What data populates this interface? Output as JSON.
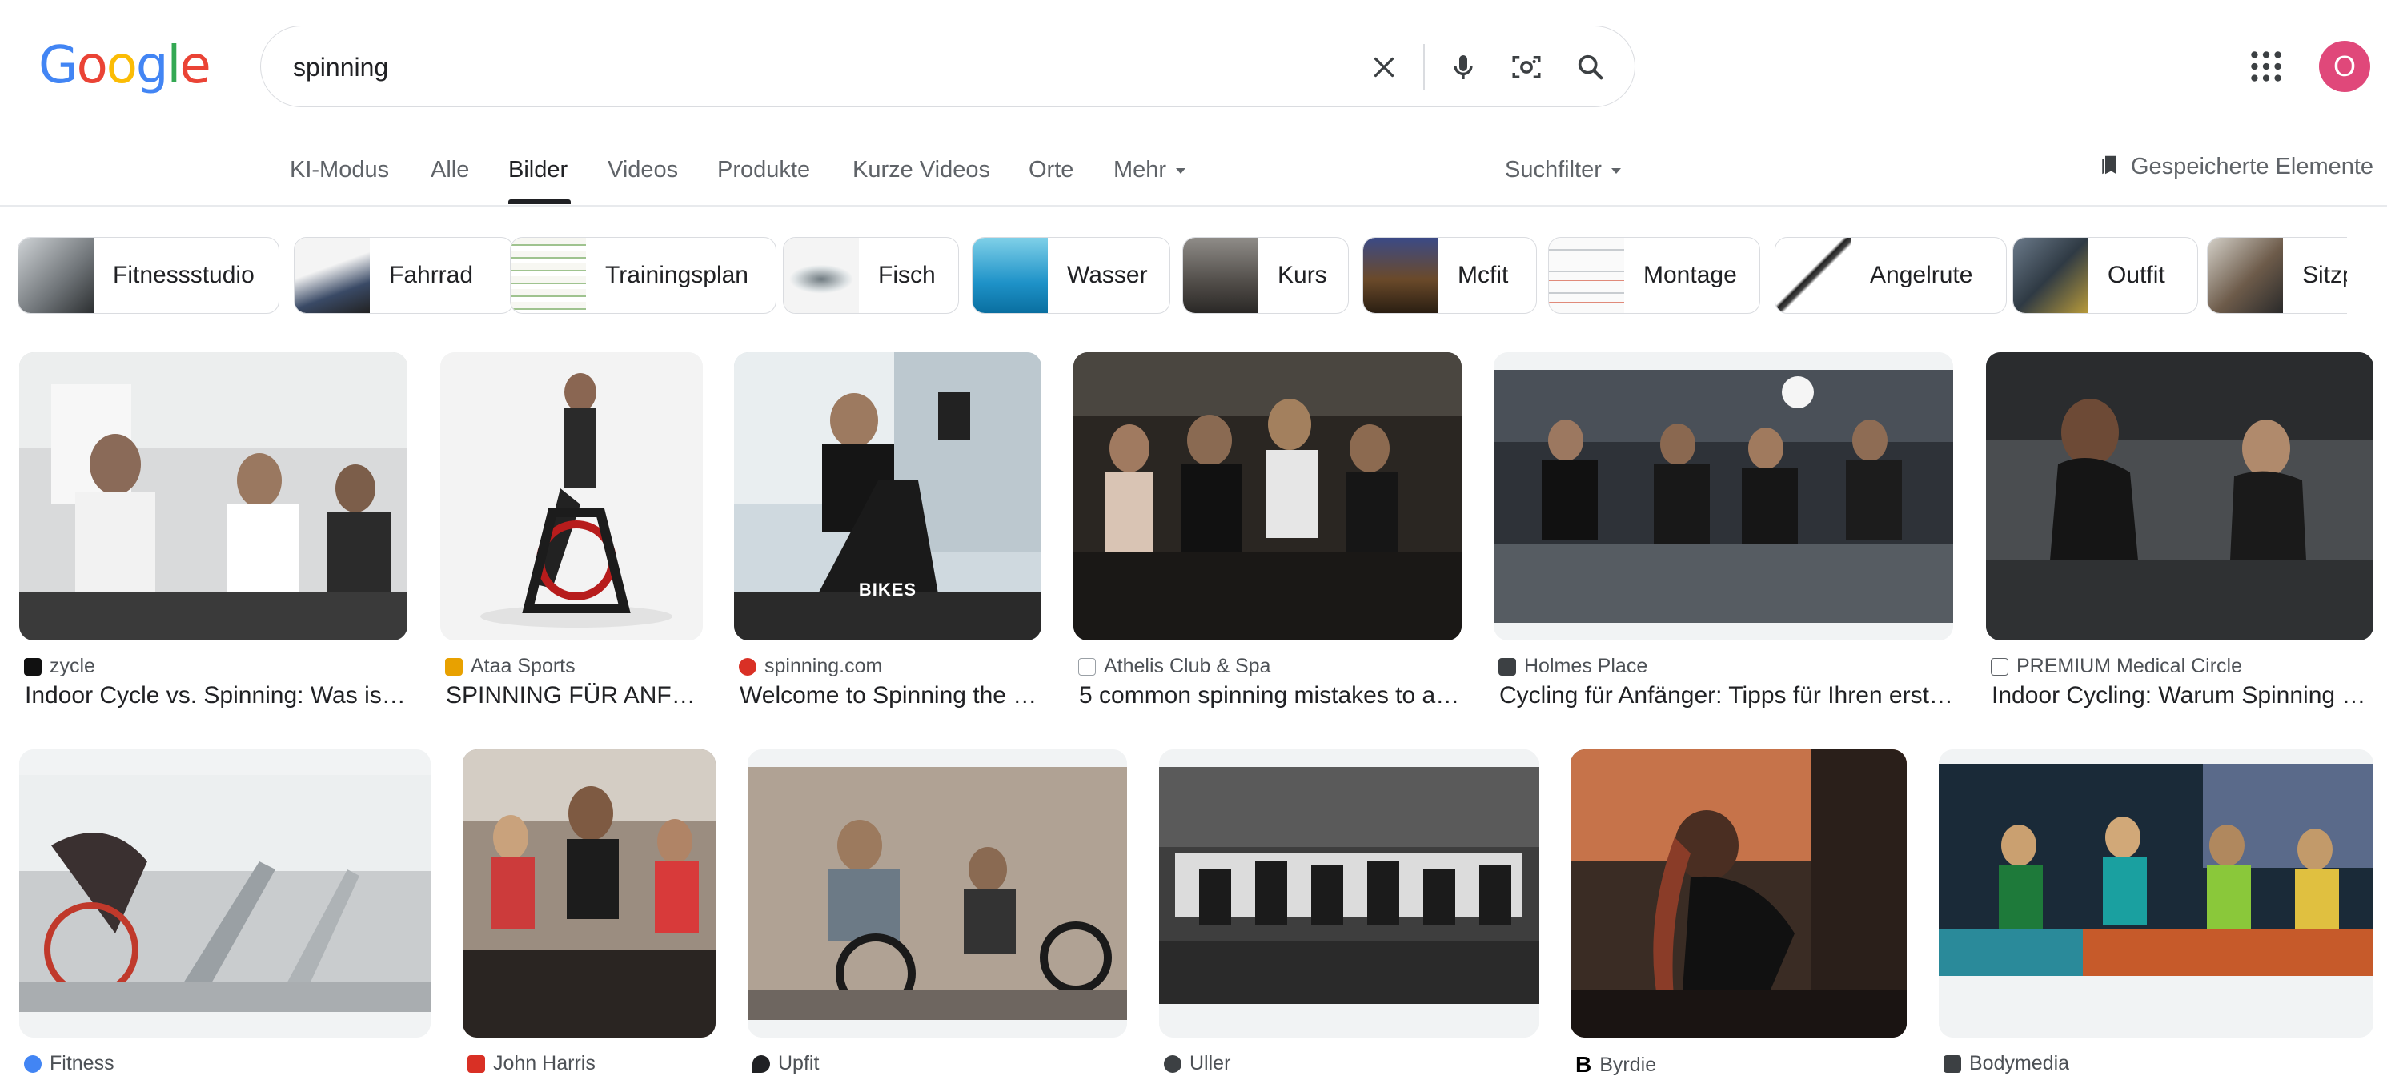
{
  "logo": "Google",
  "search": {
    "query": "spinning"
  },
  "user": {
    "avatar_letter": "O"
  },
  "tabs": [
    {
      "label": "KI-Modus"
    },
    {
      "label": "Alle"
    },
    {
      "label": "Bilder"
    },
    {
      "label": "Videos"
    },
    {
      "label": "Produkte"
    },
    {
      "label": "Kurze Videos"
    },
    {
      "label": "Orte"
    },
    {
      "label": "Mehr"
    }
  ],
  "filters": {
    "label": "Suchfilter"
  },
  "saved": {
    "label": "Gespeicherte Elemente"
  },
  "chips": [
    {
      "label": "Fitnessstudio"
    },
    {
      "label": "Fahrrad"
    },
    {
      "label": "Trainingsplan"
    },
    {
      "label": "Fisch"
    },
    {
      "label": "Wasser"
    },
    {
      "label": "Kurs"
    },
    {
      "label": "Mcfit"
    },
    {
      "label": "Montage"
    },
    {
      "label": "Angelrute"
    },
    {
      "label": "Outfit"
    },
    {
      "label": "Sitzp"
    }
  ],
  "results_row1": [
    {
      "source": "zycle",
      "title": "Indoor Cycle vs. Spinning: Was ist…",
      "fav_color": "#111111"
    },
    {
      "source": "Ataa Sports",
      "title": "SPINNING FÜR ANF…",
      "fav_color": "#e8a100"
    },
    {
      "source": "spinning.com",
      "title": "Welcome to Spinning the …",
      "fav_color": "#d93025",
      "caption": "BIKES"
    },
    {
      "source": "Athelis Club & Spa",
      "title": "5 common spinning mistakes to a…",
      "fav_color": "#9aa0a6"
    },
    {
      "source": "Holmes Place",
      "title": "Cycling für Anfänger: Tipps für Ihren erst…",
      "fav_color": "#3c4043"
    },
    {
      "source": "PREMIUM Medical Circle",
      "title": "Indoor Cycling: Warum Spinning s…",
      "fav_color": "#5f6368"
    }
  ],
  "results_row2": [
    {
      "source": "Fitness",
      "fav_color": "#4285f4"
    },
    {
      "source": "John Harris",
      "fav_color": "#d93025"
    },
    {
      "source": "Upfit",
      "fav_color": "#202124"
    },
    {
      "source": "Uller",
      "fav_color": "#3c4043"
    },
    {
      "source": "Byrdie",
      "fav_color": "#000000"
    },
    {
      "source": "Bodymedia",
      "fav_color": "#3c4043"
    }
  ]
}
